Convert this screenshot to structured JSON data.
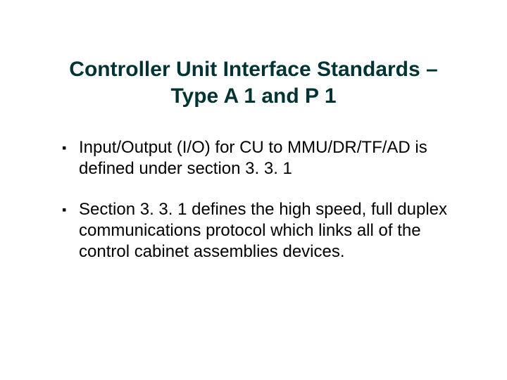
{
  "title": "Controller Unit Interface Standards – Type A 1 and P 1",
  "bullets": [
    "Input/Output (I/O) for CU to MMU/DR/TF/AD is defined under section 3. 3. 1",
    "Section 3. 3. 1 defines the high speed, full duplex communications protocol which links all of the control cabinet assemblies devices."
  ]
}
